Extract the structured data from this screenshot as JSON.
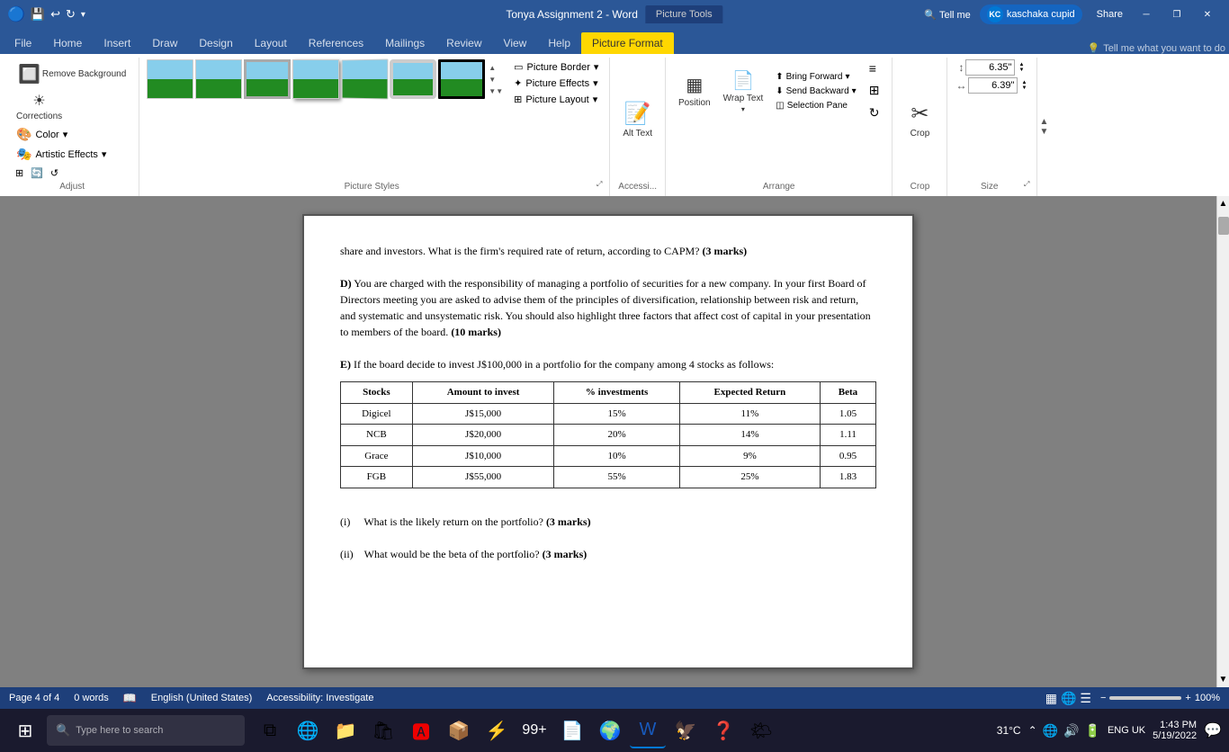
{
  "titleBar": {
    "appName": "Tonya Assignment 2 - Word",
    "tabLabel": "Picture Tools",
    "userName": "kaschaka cupid",
    "userInitials": "KC",
    "winButtons": [
      "—",
      "❐",
      "✕"
    ]
  },
  "quickAccess": [
    "💾",
    "↩",
    "↻",
    "▾"
  ],
  "ribbonTabs": [
    {
      "label": "File",
      "active": false
    },
    {
      "label": "Home",
      "active": false
    },
    {
      "label": "Insert",
      "active": false
    },
    {
      "label": "Draw",
      "active": false
    },
    {
      "label": "Design",
      "active": false
    },
    {
      "label": "Layout",
      "active": false
    },
    {
      "label": "References",
      "active": false
    },
    {
      "label": "Mailings",
      "active": false
    },
    {
      "label": "Review",
      "active": false
    },
    {
      "label": "View",
      "active": false
    },
    {
      "label": "Help",
      "active": false
    },
    {
      "label": "Picture Format",
      "active": true
    }
  ],
  "ribbon": {
    "groups": {
      "adjust": {
        "label": "Adjust",
        "removeBackground": "Remove Background",
        "corrections": "Corrections",
        "color": "Color",
        "artisticEffects": "Artistic Effects",
        "icons": [
          "🔲",
          "🎨",
          "🎭"
        ]
      },
      "pictureStyles": {
        "label": "Picture Styles",
        "pictureBorder": "Picture Border",
        "pictureEffects": "Picture Effects",
        "pictureLayout": "Picture Layout"
      },
      "accessibility": {
        "label": "Accessi...",
        "altText": "Alt Text"
      },
      "arrange": {
        "label": "Arrange",
        "position": "Position",
        "wrapText": "Wrap Text",
        "bringForward": "Bring Forward",
        "sendBackward": "Send Backward",
        "selectionPane": "Selection Pane",
        "alignIcon": "≡",
        "groupIcon": "⊞",
        "rotateIcon": "↻"
      },
      "size": {
        "label": "Size",
        "height": "6.35\"",
        "width": "6.39\""
      },
      "crop": {
        "label": "Crop",
        "btnLabel": "Crop"
      }
    }
  },
  "document": {
    "paragraphD": {
      "text": "You are charged with the responsibility of managing a portfolio of securities for a new company. In your first Board of Directors meeting you are asked to advise them of the principles of diversification, relationship between risk and return, and systematic and unsystematic risk. You should also highlight three factors that affect cost of capital in your presentation to members of the board.",
      "marks": "(10 marks)"
    },
    "paragraphE": {
      "intro": "If the board decide to invest J$100,000 in a portfolio for the company among 4 stocks as follows:",
      "table": {
        "headers": [
          "Stocks",
          "Amount to invest",
          "% investments",
          "Expected Return",
          "Beta"
        ],
        "rows": [
          [
            "Digicel",
            "J$15,000",
            "15%",
            "11%",
            "1.05"
          ],
          [
            "NCB",
            "J$20,000",
            "20%",
            "14%",
            "1.11"
          ],
          [
            "Grace",
            "J$10,000",
            "10%",
            "9%",
            "0.95"
          ],
          [
            "FGB",
            "J$55,000",
            "55%",
            "25%",
            "1.83"
          ]
        ]
      },
      "questionI": "(i)   What is the likely return on the portfolio?",
      "questionIMarks": "(3 marks)",
      "questionII": "(ii)   What would be the beta of the portfolio?",
      "questionIIMarks": "(3 marks)"
    },
    "introText": "share and investors. What is the firm's required rate of return, according to CAPM?",
    "introMarks": "(3 marks)"
  },
  "statusBar": {
    "page": "Page 4 of 4",
    "words": "0 words",
    "language": "English (United States)",
    "accessibility": "Accessibility: Investigate",
    "zoom": "100%"
  },
  "taskbar": {
    "searchPlaceholder": "Type here to search",
    "temperature": "31°C",
    "time": "1:43 PM",
    "date": "5/19/2022",
    "language": "ENG UK",
    "icons": [
      "⊞",
      "🔍",
      "◉",
      "📋",
      "🌐",
      "📦",
      "🅰",
      "🔵",
      "🟣",
      "📄",
      "🦅",
      "❓",
      "🌤"
    ]
  }
}
